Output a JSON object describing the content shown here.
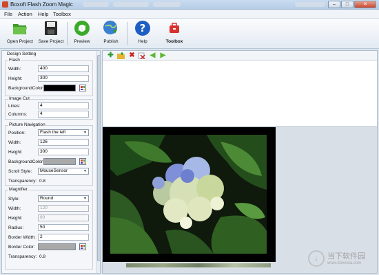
{
  "window": {
    "title": "Boxoft Flash Zoom Magic",
    "buttons": {
      "minimize": "–",
      "maximize": "□",
      "close": "✕"
    }
  },
  "menu": [
    "File",
    "Action",
    "Help",
    "Toolbox"
  ],
  "toolbar": {
    "open_project": "Open Project",
    "save_project": "Save Project",
    "preview": "Preview",
    "publish": "Publish",
    "help": "Help",
    "toolbox": "Toolbox"
  },
  "design": {
    "title": "Design Setting",
    "flash": {
      "title": "Flash",
      "width_label": "Width:",
      "width": "400",
      "height_label": "Height:",
      "height": "300",
      "bgcolor_label": "BackgroundColor:",
      "bgcolor": "#000000"
    },
    "image_cut": {
      "title": "Image Cut",
      "lines_label": "Lines:",
      "lines": "4",
      "columns_label": "Columns:",
      "columns": "4"
    },
    "picture_nav": {
      "title": "Picture Navigation",
      "position_label": "Position:",
      "position": "Flash the left",
      "width_label": "Width:",
      "width": "126",
      "height_label": "Height:",
      "height": "300",
      "bgcolor_label": "BackgroundColor:",
      "bgcolor": "#a9a9a9",
      "scroll_label": "Scroll Style:",
      "scroll": "MouseSensor",
      "transparency_label": "Transparency:",
      "transparency": "0.8"
    },
    "magnifier": {
      "title": "Magnifier",
      "style_label": "Style:",
      "style": "Round",
      "width_label": "Width:",
      "width": "120",
      "height_label": "Height:",
      "height": "90",
      "radius_label": "Radius:",
      "radius": "50",
      "border_width_label": "Border Width:",
      "border_width": "2",
      "border_color_label": "Border Color:",
      "border_color": "#a9a9a9",
      "transparency_label": "Transparency:",
      "transparency": "0.8"
    }
  },
  "watermark": {
    "text": "当下软件园",
    "sub": "www.downxia.com"
  },
  "colors": {
    "accent_green": "#2e9a2e",
    "delete_red": "#cc2222",
    "arrow_green": "#5cb82e"
  }
}
